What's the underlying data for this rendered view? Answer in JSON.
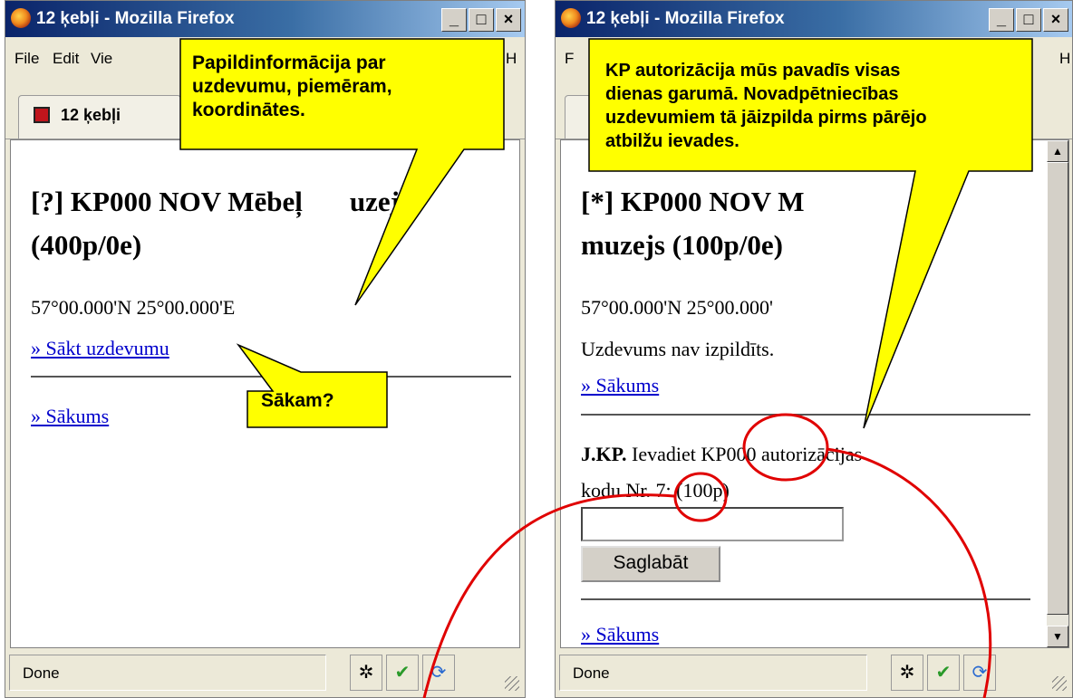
{
  "window_left": {
    "title": "12 ķebļi - Mozilla Firefox",
    "menu": [
      "File",
      "Edit",
      "Vie",
      "H"
    ],
    "tab_label": "12 ķebļi",
    "heading": "[?] KP000 NOV Mēbeļu muzejs (400p/0e)",
    "heading_line1": "[?] KP000 NOV Mēbeļ",
    "heading_line1b": "uzejs",
    "heading_line2": "(400p/0e)",
    "coords": "57°00.000'N 25°00.000'E",
    "start_link": "» Sākt uzdevumu",
    "home_link": "» Sākums",
    "status": "Done"
  },
  "window_right": {
    "title": "12 ķebļi - Mozilla Firefox",
    "menu_left": "F",
    "menu_right": "H",
    "heading_line1": "[*] KP000 NOV M",
    "heading_line2": "muzejs (100p/0e)",
    "coords": "57°00.000'N 25°00.000'",
    "not_done": "Uzdevums nav izpildīts.",
    "home_link": "» Sākums",
    "auth_bold": "J.KP.",
    "auth_text": "Ievadiet KP000 autorizācijas",
    "auth_text2": "kodu Nr. 7: (100p)",
    "save_button": "Saglabāt",
    "home_link2": "» Sākums",
    "status": "Done"
  },
  "callouts": {
    "info": "Papildinformācija par uzdevumu, piemēram, koordinātes.",
    "info_lines": [
      "Papildinformācija par",
      "uzdevumu, piemēram,",
      "koordinātes."
    ],
    "start": "Sākam?",
    "auth_lines": [
      "KP autorizācija mūs pavadīs visas",
      "dienas garumā. Novadpētniecības",
      "uzdevumiem tā jāizpilda pirms pārējo",
      "atbilžu ievades."
    ]
  },
  "colors": {
    "callout_fill": "#ffff00",
    "circle": "#e00000",
    "link": "#0000cc"
  }
}
